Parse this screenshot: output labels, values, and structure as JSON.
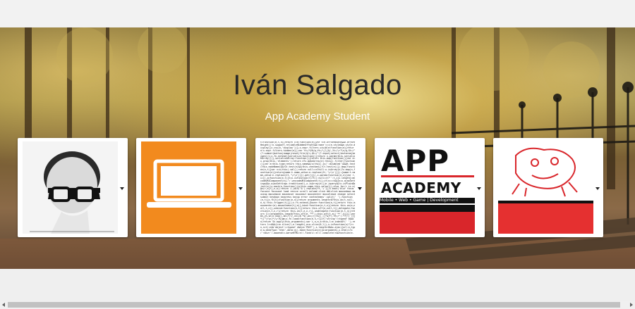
{
  "header": {
    "name": "Iván Salgado",
    "subtitle": "App Academy Student"
  },
  "cards": [
    {
      "icon": "portrait-with-glasses-icon"
    },
    {
      "icon": "laptop-icon",
      "color": "#f28a1e"
    },
    {
      "icon": "code-text-icon",
      "code": "t=function(e,t,n){return c=e;function(e){var t=e.offsetWidth&&e.offsetHeight||!x.support.reliableHiddenOffsets&&'none'===(e.style&&e.style.display||x.css(e,'display'))};x.expr.filters.visible=function(e){return!x.expr.filters.hidden(e)};var Yt=/%20/g,Vt=/\\[\\]$/,Jt=/\\r?\\n/g,Gt=/^(?:submit|button|image|reset|file)$/i,Qt=/^(?:input|select|textarea|keygen)/i;x.fn.extend({serialize:function(){return x.param(this.serializeArray())},serializeArray:function(){return this.map(function(){var e=x.prop(this,'elements');return e?x.makeArray(e):this}).filter(function(){var e=this.type;return this.name&&!x(this).is(':disabled')&&Qt.test(this.nodeName)&&!Gt.test(e)&&(this.checked||!Ct.test(e))}).map(function(e,t){var n=x(this).val();return null==n?null:x.isArray(n)?x.map(n,function(e){return{name:t.name,value:e.replace(Jt,'\\r\\n')}}):{name:t.name,value:n.replace(Jt,'\\r\\n')}}).get()}}),x.param=function(e,n){var r,i=[],o=function(e,t){t=x.isFunction(t)?t():null==t?'':t,i[i.length]=encodeURIComponent(e)+'='+encodeURIComponent(t)};if(n===t&&(n=x.ajaxSettings&&x.ajaxSettings.traditional),x.isArray(e)||e.jquery&&!x.isPlainObject(e))x.each(e,function(){o(this.name,this.value)});else for(r in e)gn(r,e[r],n,o);return i.join('&').replace(Yt,'+')};x.each('blur focus focusin focusout load resize scroll unload click dblclick mousedown mouseup mousemove mouseover mouseout mouseenter mouseleave change select submit keydown keypress keyup error contextmenu'.split(' '),function(e,t){x.fn[t]=function(e,n){return arguments.length>0?this.on(t,null,e,n):this.trigger(t)}});x.fn.extend({hover:function(e,t){return this.mouseenter(e).mouseleave(t||e)},bind:function(e,t,n){return this.on(e,null,t,n)},unbind:function(e,t){return this.off(e,null,t)},delegate:function(e,t,n,r){return this.on(t,e,n,r)},undelegate:function(e,t,n){return 1===arguments.length?this.off(e,'**'):this.off(t,e||'**',n)}});var mn,yn,vn=x.now(),bn=/\\?/,xn=/#.*$/,wn=/([?&])_=[^&]*/,Tn=/^(.*?):[ \\t]*([^\\r\\n]*)\\r?$/gm;x.fn.load=function(e,n,r){if('string'!=typeof e&&Sn)return Sn.apply(this,arguments);var i,o,a,s=this,l=e.indexOf(' ');return l>=0&&(i=e.slice(l,e.length),e=e.slice(0,l)),x.isFunction(n)?(r=n,n=t):n&&'object'==typeof n&&(a='POST'),s.length>0&&x.ajax({url:e,type:a,dataType:'html',data:n}).done(function(e){o=arguments,s.html(i?x('<div>').append(x.parseHTML(e)).find(i):e)}).complete(r&&function(e,t){s.each(r,o||[e.responseText,t,e])}),this};x.each(['ajaxStart','ajaxStop','ajaxComplete','ajaxError','ajaxSuccess','ajaxSend'],function(e,t){x.fn[t]=function(e){return this.on(t,e)}});x.extend({active:0,lastModified:{},etag:{},ajaxSettings:{url:yn,type:'GET',isLocal:Nn.test(mn[1]),global:!0,processData:!0,async:!0,contentType:'application/x-www-form-urlencoded; charset=UTF-8',accepts:{'*':Dn,text:'text/plain',html:'text/html'}}})"
    },
    {
      "icon": "app-academy-logo-icon",
      "logo_line1": "APP",
      "logo_line2": "ACADEMY",
      "tagline": "Mobile • Web • Game | Development"
    },
    {
      "icon": "bulldog-mascot-icon"
    }
  ],
  "colors": {
    "brand_red": "#d9262b",
    "dark_text": "#2a2a2a"
  }
}
